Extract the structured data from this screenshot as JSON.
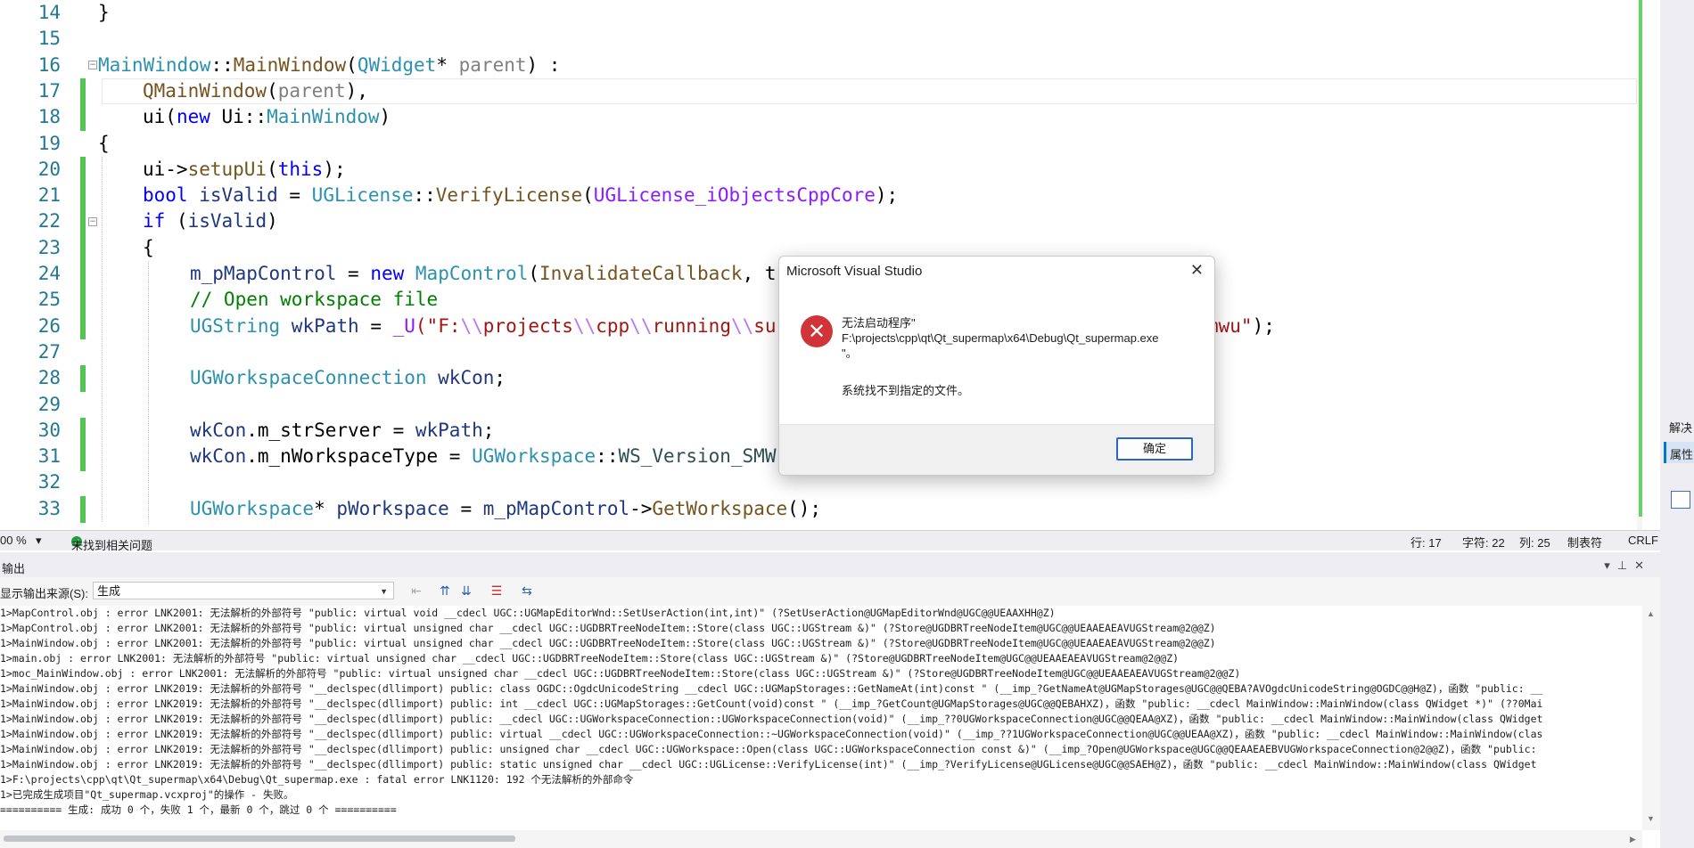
{
  "editor": {
    "line_numbers": [
      "14",
      "15",
      "16",
      "17",
      "18",
      "19",
      "20",
      "21",
      "22",
      "23",
      "24",
      "25",
      "26",
      "27",
      "28",
      "29",
      "30",
      "31",
      "32",
      "33"
    ],
    "code": {
      "l14": "}",
      "l16_a": "MainWindow",
      "l16_b": "::",
      "l16_c": "MainWindow",
      "l16_d": "(",
      "l16_e": "QWidget",
      "l16_f": "* ",
      "l16_g": "parent",
      "l16_h": ") :",
      "l17_a": "QMainWindow",
      "l17_b": "(",
      "l17_c": "parent",
      "l17_d": "),",
      "l18_a": "ui(",
      "l18_b": "new",
      "l18_c": " Ui::",
      "l18_d": "MainWindow",
      "l18_e": ")",
      "l19": "{",
      "l20_a": "ui->",
      "l20_b": "setupUi",
      "l20_c": "(",
      "l20_d": "this",
      "l20_e": ");",
      "l21_a": "bool",
      "l21_b": " isValid",
      "l21_c": " = ",
      "l21_d": "UGLicense",
      "l21_e": "::",
      "l21_f": "VerifyLicense",
      "l21_g": "(",
      "l21_h": "UGLicense_iObjectsCppCore",
      "l21_i": ");",
      "l22_a": "if",
      "l22_b": " (",
      "l22_c": "isValid",
      "l22_d": ")",
      "l23": "{",
      "l24_a": "m_pMapControl",
      "l24_b": " = ",
      "l24_c": "new",
      "l24_d": " ",
      "l24_e": "MapControl",
      "l24_f": "(",
      "l24_g": "InvalidateCallback",
      "l24_h": ", t",
      "l25": "// Open workspace file",
      "l26_a": "UGString",
      "l26_b": " wkPath",
      "l26_c": " = ",
      "l26_d": "_U",
      "l26_e": "(\"F:",
      "l26_f": "\\\\",
      "l26_g": "projects",
      "l26_h": "\\\\",
      "l26_i": "cpp",
      "l26_j": "\\\\",
      "l26_k": "running",
      "l26_l": "\\\\",
      "l26_m": "su",
      "l26_tail_a": "mwu\"",
      "l26_tail_b": ");",
      "l28_a": "UGWorkspaceConnection",
      "l28_b": " wkCon",
      "l28_c": ";",
      "l30_a": "wkCon",
      "l30_b": ".m_strServer",
      "l30_c": " = ",
      "l30_d": "wkPath",
      "l30_e": ";",
      "l31_a": "wkCon",
      "l31_b": ".m_nWorkspaceType",
      "l31_c": " = ",
      "l31_d": "UGWorkspace",
      "l31_e": "::",
      "l31_f": "WS_Version_SMW",
      "l33_a": "UGWorkspace",
      "l33_b": "* ",
      "l33_c": "pWorkspace",
      "l33_d": " = ",
      "l33_e": "m_pMapControl",
      "l33_f": "->",
      "l33_g": "GetWorkspace",
      "l33_h": "();"
    }
  },
  "status": {
    "zoom": "00 %",
    "issues": "未找到相关问题",
    "line": "行: 17",
    "char": "字符: 22",
    "col": "列: 25",
    "tab": "制表符",
    "eol": "CRLF"
  },
  "side_panel": {
    "label_solve": "解决",
    "label_props": "属性"
  },
  "output": {
    "title": "输出",
    "source_label": "显示输出来源(S):",
    "source_value": "生成",
    "lines": [
      "1>MapControl.obj : error LNK2001: 无法解析的外部符号 \"public: virtual void __cdecl UGC::UGMapEditorWnd::SetUserAction(int,int)\" (?SetUserAction@UGMapEditorWnd@UGC@@UEAAXHH@Z)",
      "1>MapControl.obj : error LNK2001: 无法解析的外部符号 \"public: virtual unsigned char __cdecl UGC::UGDBRTreeNodeItem::Store(class UGC::UGStream &)\" (?Store@UGDBRTreeNodeItem@UGC@@UEAAEAEAVUGStream@2@@Z)",
      "1>MainWindow.obj : error LNK2001: 无法解析的外部符号 \"public: virtual unsigned char __cdecl UGC::UGDBRTreeNodeItem::Store(class UGC::UGStream &)\" (?Store@UGDBRTreeNodeItem@UGC@@UEAAEAEAVUGStream@2@@Z)",
      "1>main.obj : error LNK2001: 无法解析的外部符号 \"public: virtual unsigned char __cdecl UGC::UGDBRTreeNodeItem::Store(class UGC::UGStream &)\" (?Store@UGDBRTreeNodeItem@UGC@@UEAAEAEAVUGStream@2@@Z)",
      "1>moc_MainWindow.obj : error LNK2001: 无法解析的外部符号 \"public: virtual unsigned char __cdecl UGC::UGDBRTreeNodeItem::Store(class UGC::UGStream &)\" (?Store@UGDBRTreeNodeItem@UGC@@UEAAEAEAVUGStream@2@@Z)",
      "1>MainWindow.obj : error LNK2019: 无法解析的外部符号 \"__declspec(dllimport) public: class OGDC::OgdcUnicodeString __cdecl UGC::UGMapStorages::GetNameAt(int)const \" (__imp_?GetNameAt@UGMapStorages@UGC@@QEBA?AVOgdcUnicodeString@OGDC@@H@Z)，函数 \"public: __",
      "1>MainWindow.obj : error LNK2019: 无法解析的外部符号 \"__declspec(dllimport) public: int __cdecl UGC::UGMapStorages::GetCount(void)const \" (__imp_?GetCount@UGMapStorages@UGC@@QEBAHXZ)，函数 \"public: __cdecl MainWindow::MainWindow(class QWidget *)\" (??0Mai",
      "1>MainWindow.obj : error LNK2019: 无法解析的外部符号 \"__declspec(dllimport) public: __cdecl UGC::UGWorkspaceConnection::UGWorkspaceConnection(void)\" (__imp_??0UGWorkspaceConnection@UGC@@QEAA@XZ)，函数 \"public: __cdecl MainWindow::MainWindow(class QWidget",
      "1>MainWindow.obj : error LNK2019: 无法解析的外部符号 \"__declspec(dllimport) public: virtual __cdecl UGC::UGWorkspaceConnection::~UGWorkspaceConnection(void)\" (__imp_??1UGWorkspaceConnection@UGC@@UEAA@XZ)，函数 \"public: __cdecl MainWindow::MainWindow(clas",
      "1>MainWindow.obj : error LNK2019: 无法解析的外部符号 \"__declspec(dllimport) public: unsigned char __cdecl UGC::UGWorkspace::Open(class UGC::UGWorkspaceConnection const &)\" (__imp_?Open@UGWorkspace@UGC@@QEAAEAEBVUGWorkspaceConnection@2@@Z)，函数 \"public:",
      "1>MainWindow.obj : error LNK2019: 无法解析的外部符号 \"__declspec(dllimport) public: static unsigned char __cdecl UGC::UGLicense::VerifyLicense(int)\" (__imp_?VerifyLicense@UGLicense@UGC@@SAEH@Z)，函数 \"public: __cdecl MainWindow::MainWindow(class QWidget",
      "1>F:\\projects\\cpp\\qt\\Qt_supermap\\x64\\Debug\\Qt_supermap.exe : fatal error LNK1120: 192 个无法解析的外部命令",
      "1>已完成生成项目\"Qt_supermap.vcxproj\"的操作 - 失败。",
      "========== 生成: 成功 0 个，失败 1 个，最新 0 个，跳过 0 个 =========="
    ]
  },
  "dialog": {
    "title": "Microsoft Visual Studio",
    "msg_line1": "无法启动程序\"",
    "msg_line2": "F:\\projects\\cpp\\qt\\Qt_supermap\\x64\\Debug\\Qt_supermap.exe",
    "msg_line3": "\"。",
    "sub": "系统找不到指定的文件。",
    "ok": "确定"
  },
  "colors": {
    "keyword": "#0000ff",
    "type": "#2b91af",
    "function": "#74531f",
    "comment": "#008000",
    "string": "#a31515",
    "error_icon": "#d13438",
    "change_marker": "#55c455"
  },
  "icons": [
    "fold-icon",
    "check-circle-icon",
    "error-x-icon",
    "close-icon",
    "dropdown-arrow-icon",
    "output-toolbar-icons"
  ]
}
